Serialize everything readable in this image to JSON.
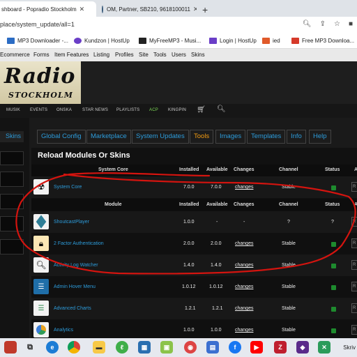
{
  "browser": {
    "tabs": [
      {
        "label": "shboard - Popradio Stockholm"
      },
      {
        "label": "OM, Partner, SB210, 9618100011"
      }
    ],
    "url": "place/system_update/all=1",
    "bookmarks": [
      {
        "label": "MP3 Downloader -...",
        "color": "#2b6cc4"
      },
      {
        "label": "Kundzon | HostUp",
        "color": "#6a3ec7"
      },
      {
        "label": "MyFreeMP3 - Musi...",
        "color": "#222222"
      },
      {
        "label": "Login | HostUp",
        "color": "#6a3ec7"
      },
      {
        "label": "ied",
        "color": "#e05a2a"
      },
      {
        "label": "Free MP3 Downloa...",
        "color": "#d63a2a"
      }
    ]
  },
  "admin_nav": [
    "Ecommerce",
    "Forms",
    "Item Features",
    "Listing",
    "Profiles",
    "Site",
    "Tools",
    "Users",
    "Skins"
  ],
  "logo": {
    "line1": "Radio",
    "line2": "STOCKHOLM"
  },
  "site_nav": [
    "MUSIK",
    "EVENTS",
    "ONSKA",
    "STAR NEWS",
    "PLAYLISTS",
    "ACP",
    "KINGPIN"
  ],
  "left": {
    "skins_label": "Skins"
  },
  "tabs": [
    {
      "label": "Global Config",
      "active": false
    },
    {
      "label": "Marketplace",
      "active": false
    },
    {
      "label": "System Updates",
      "active": false
    },
    {
      "label": "Tools",
      "active": true
    },
    {
      "label": "Images",
      "active": false
    },
    {
      "label": "Templates",
      "active": false
    },
    {
      "label": "Info",
      "active": false
    },
    {
      "label": "Help",
      "active": false
    }
  ],
  "panel": {
    "title": "Reload Modules Or Skins",
    "headers": {
      "system_core": "System Core",
      "module": "Module",
      "installed": "Installed",
      "available": "Available",
      "changes": "Changes",
      "channel": "Channel",
      "status": "Status",
      "edge": "A"
    },
    "core_rows": [
      {
        "name": "System Core",
        "installed": "7.0.0",
        "available": "7.0.0",
        "changes": "changes",
        "channel": "Stable",
        "status": "ok",
        "icon": "radiation-icon"
      }
    ],
    "module_rows": [
      {
        "name": "ShoutcastPlayer",
        "installed": "1.0.0",
        "available": "-",
        "changes": "-",
        "channel": "?",
        "status": "?",
        "icon": "cube-icon"
      },
      {
        "name": "2 Factor Authentication",
        "installed": "2.0.0",
        "available": "2.0.0",
        "changes": "changes",
        "channel": "Stable",
        "status": "ok",
        "icon": "lock-icon"
      },
      {
        "name": "Activity Log Watcher",
        "installed": "1.4.0",
        "available": "1.4.0",
        "changes": "changes",
        "channel": "Stable",
        "status": "ok",
        "icon": "magnifier-icon"
      },
      {
        "name": "Admin Hover Menu",
        "installed": "1.0.12",
        "available": "1.0.12",
        "changes": "changes",
        "channel": "Stable",
        "status": "ok",
        "icon": "menu-icon"
      },
      {
        "name": "Advanced Charts",
        "installed": "1.2.1",
        "available": "1.2.1",
        "changes": "changes",
        "channel": "Stable",
        "status": "ok",
        "icon": "chart-icon"
      },
      {
        "name": "Analytics",
        "installed": "1.0.0",
        "available": "1.0.0",
        "changes": "changes",
        "channel": "Stable",
        "status": "ok",
        "icon": "pie-icon"
      }
    ]
  },
  "taskbar": {
    "right_label": "Skriv"
  }
}
